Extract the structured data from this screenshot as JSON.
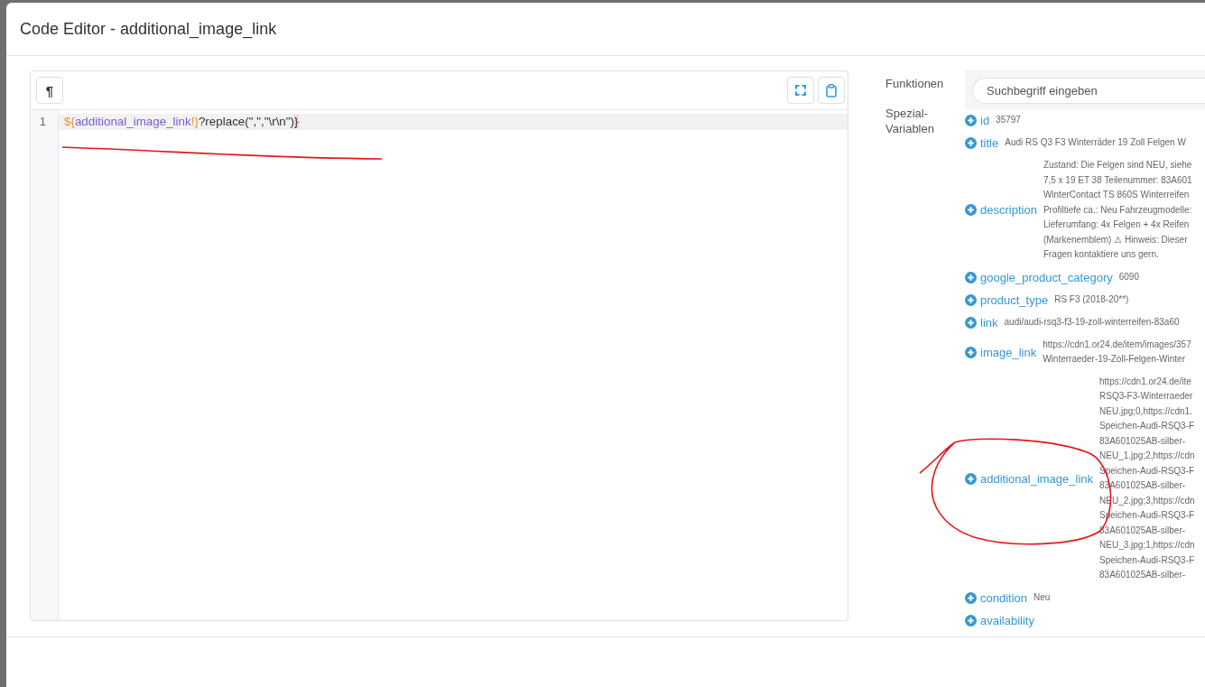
{
  "dialog": {
    "title": "Code Editor - additional_image_link"
  },
  "editor": {
    "toolbar": {
      "buttons": [
        {
          "glyph": "¶"
        }
      ]
    },
    "lines": [
      {
        "number": "1",
        "active": true,
        "underlined": true,
        "tokens": [
          {
            "text": "${",
            "kind": "delimiter"
          },
          {
            "text": "additional_image_link",
            "kind": "variable"
          },
          {
            "text": "!}",
            "kind": "delimiter"
          },
          {
            "text": "?replace(\",\",\"\\r\\n\")",
            "kind": "plain"
          },
          {
            "text": "}",
            "kind": "matched_bracket"
          }
        ]
      }
    ]
  },
  "panel": {
    "functions": {
      "label": "Funktionen",
      "search": {
        "placeholder": "Suchbegriff eingeben"
      }
    },
    "variables": {
      "label": "Spezial-Variablen",
      "items": [
        {
          "name": "id",
          "value": "35797",
          "circled": false
        },
        {
          "name": "title",
          "value": "Audi RS Q3 F3 Winterräder 19 Zoll Felgen W",
          "circled": false
        },
        {
          "name": "description",
          "lines": [
            "Zustand: Die Felgen sind NEU, siehe",
            "7,5 x 19 ET 38 Teilenummer: 83A601",
            "WinterContact TS 860S Winterreifen",
            "Profiltiefe ca.: Neu Fahrzeugmodelle:",
            "Lieferumfang: 4x Felgen + 4x Reifen",
            "(Markenemblem) ⚠ Hinweis: Dieser",
            "Fragen kontaktiere uns gern."
          ],
          "circled": false
        },
        {
          "name": "google_product_category",
          "value": "6090",
          "circled": false
        },
        {
          "name": "product_type",
          "value": "RS F3 (2018-20**)",
          "circled": false
        },
        {
          "name": "link",
          "value": "audi/audi-rsq3-f3-19-zoll-winterreifen-83a60",
          "circled": false
        },
        {
          "name": "image_link",
          "lines": [
            "https://cdn1.or24.de/item/images/357",
            "Winterraeder-19-Zoll-Felgen-Winter"
          ],
          "circled": false
        },
        {
          "name": "additional_image_link",
          "lines": [
            "https://cdn1.or24.de/ite",
            "RSQ3-F3-Winterraeder",
            "NEU.jpg;0,https://cdn1.",
            "Speichen-Audi-RSQ3-F",
            "83A601025AB-silber-",
            "NEU_1.jpg;2,https://cdn",
            "Speichen-Audi-RSQ3-F",
            "83A601025AB-silber-",
            "NEU_2.jpg;3,https://cdn",
            "Speichen-Audi-RSQ3-F",
            "83A601025AB-silber-",
            "NEU_3.jpg;1,https://cdn",
            "Speichen-Audi-RSQ3-F",
            "83A601025AB-silber-"
          ],
          "circled": true
        },
        {
          "name": "condition",
          "value": "Neu",
          "circled": false
        },
        {
          "name": "availability",
          "circled": false
        }
      ]
    }
  }
}
